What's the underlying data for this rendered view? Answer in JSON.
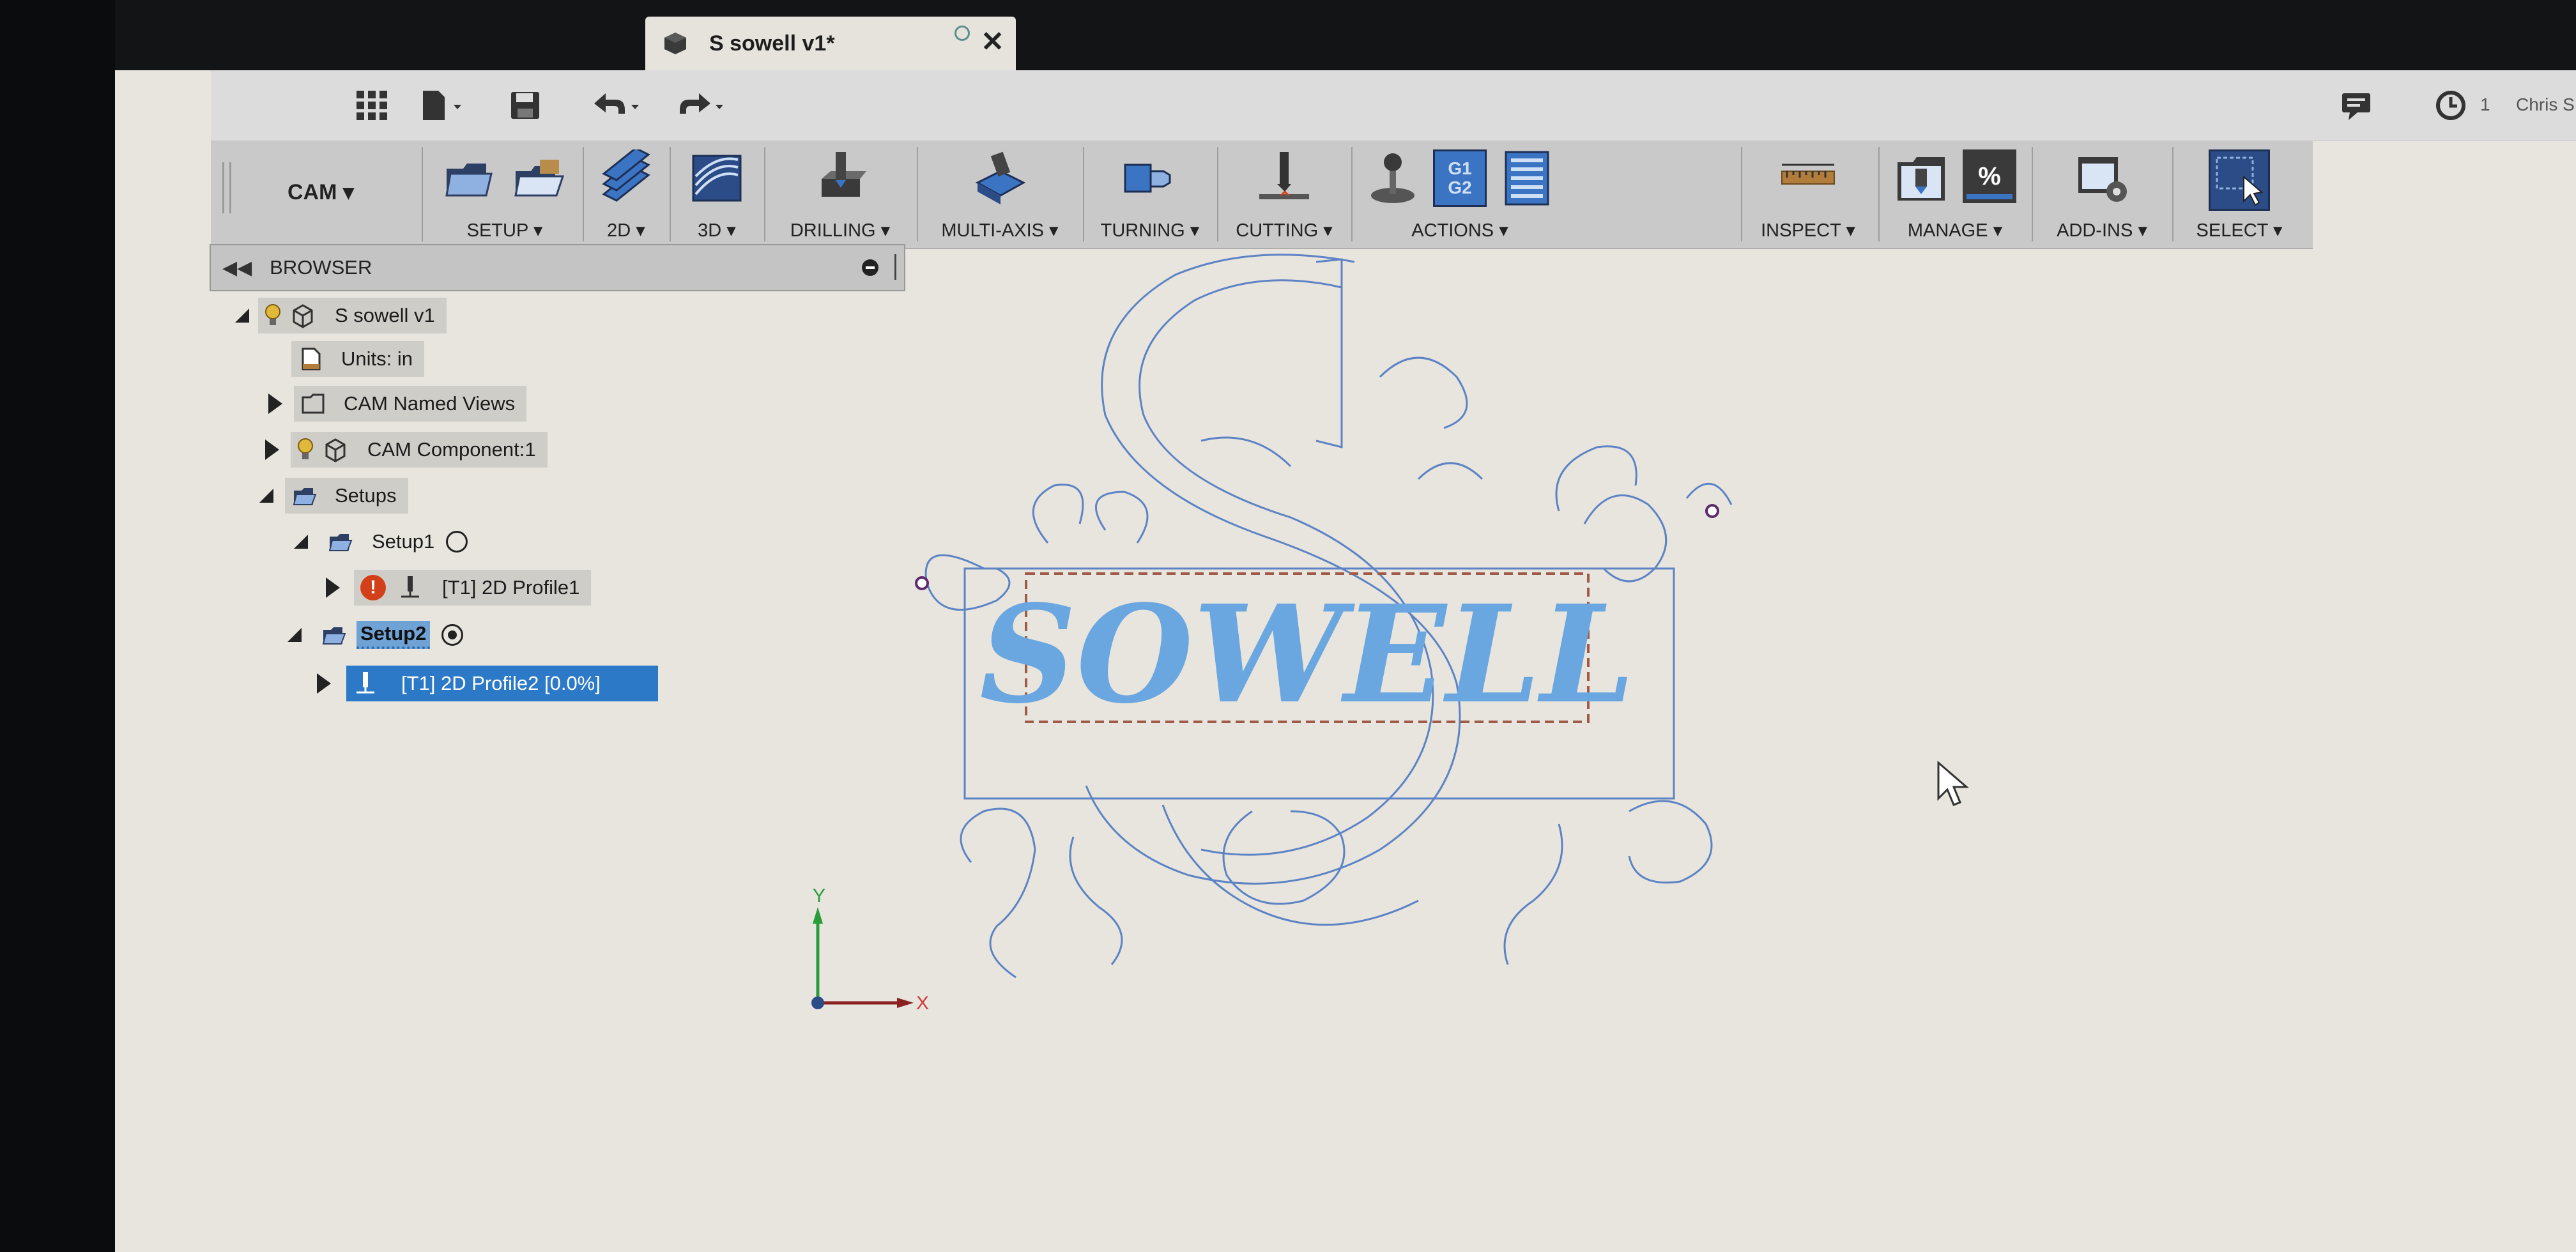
{
  "document": {
    "tab_title": "S sowell v1*"
  },
  "quick_access": {
    "user_name": "Chris S",
    "jobs_count": "1"
  },
  "ribbon": {
    "workspace": "CAM ▾",
    "groups": [
      {
        "label": "SETUP ▾"
      },
      {
        "label": "2D ▾"
      },
      {
        "label": "3D ▾"
      },
      {
        "label": "DRILLING ▾"
      },
      {
        "label": "MULTI-AXIS ▾"
      },
      {
        "label": "TURNING ▾"
      },
      {
        "label": "CUTTING ▾"
      },
      {
        "label": "ACTIONS ▾"
      },
      {
        "label": "INSPECT ▾"
      },
      {
        "label": "MANAGE ▾"
      },
      {
        "label": "ADD-INS ▾"
      },
      {
        "label": "SELECT ▾"
      }
    ],
    "actions_gcode": {
      "line1": "G1",
      "line2": "G2"
    },
    "manage_percent": "%"
  },
  "browser": {
    "title": "BROWSER",
    "root": "S sowell v1",
    "units": "Units: in",
    "named_views": "CAM Named Views",
    "component": "CAM Component:1",
    "setups": "Setups",
    "setup1": "Setup1",
    "op1": "[T1] 2D Profile1",
    "setup2": "Setup2",
    "op2": "[T1] 2D Profile2 [0.0%]"
  },
  "canvas": {
    "sign_text": "SOWELL",
    "axis_x": "X",
    "axis_y": "Y"
  },
  "colors": {
    "accent_blue": "#2c79c7",
    "model_blue": "#6aa6e0",
    "outline_blue": "#5d83c4",
    "warning_red": "#d2401a",
    "axis_green": "#2a9d3a",
    "axis_red": "#d63a3a"
  }
}
